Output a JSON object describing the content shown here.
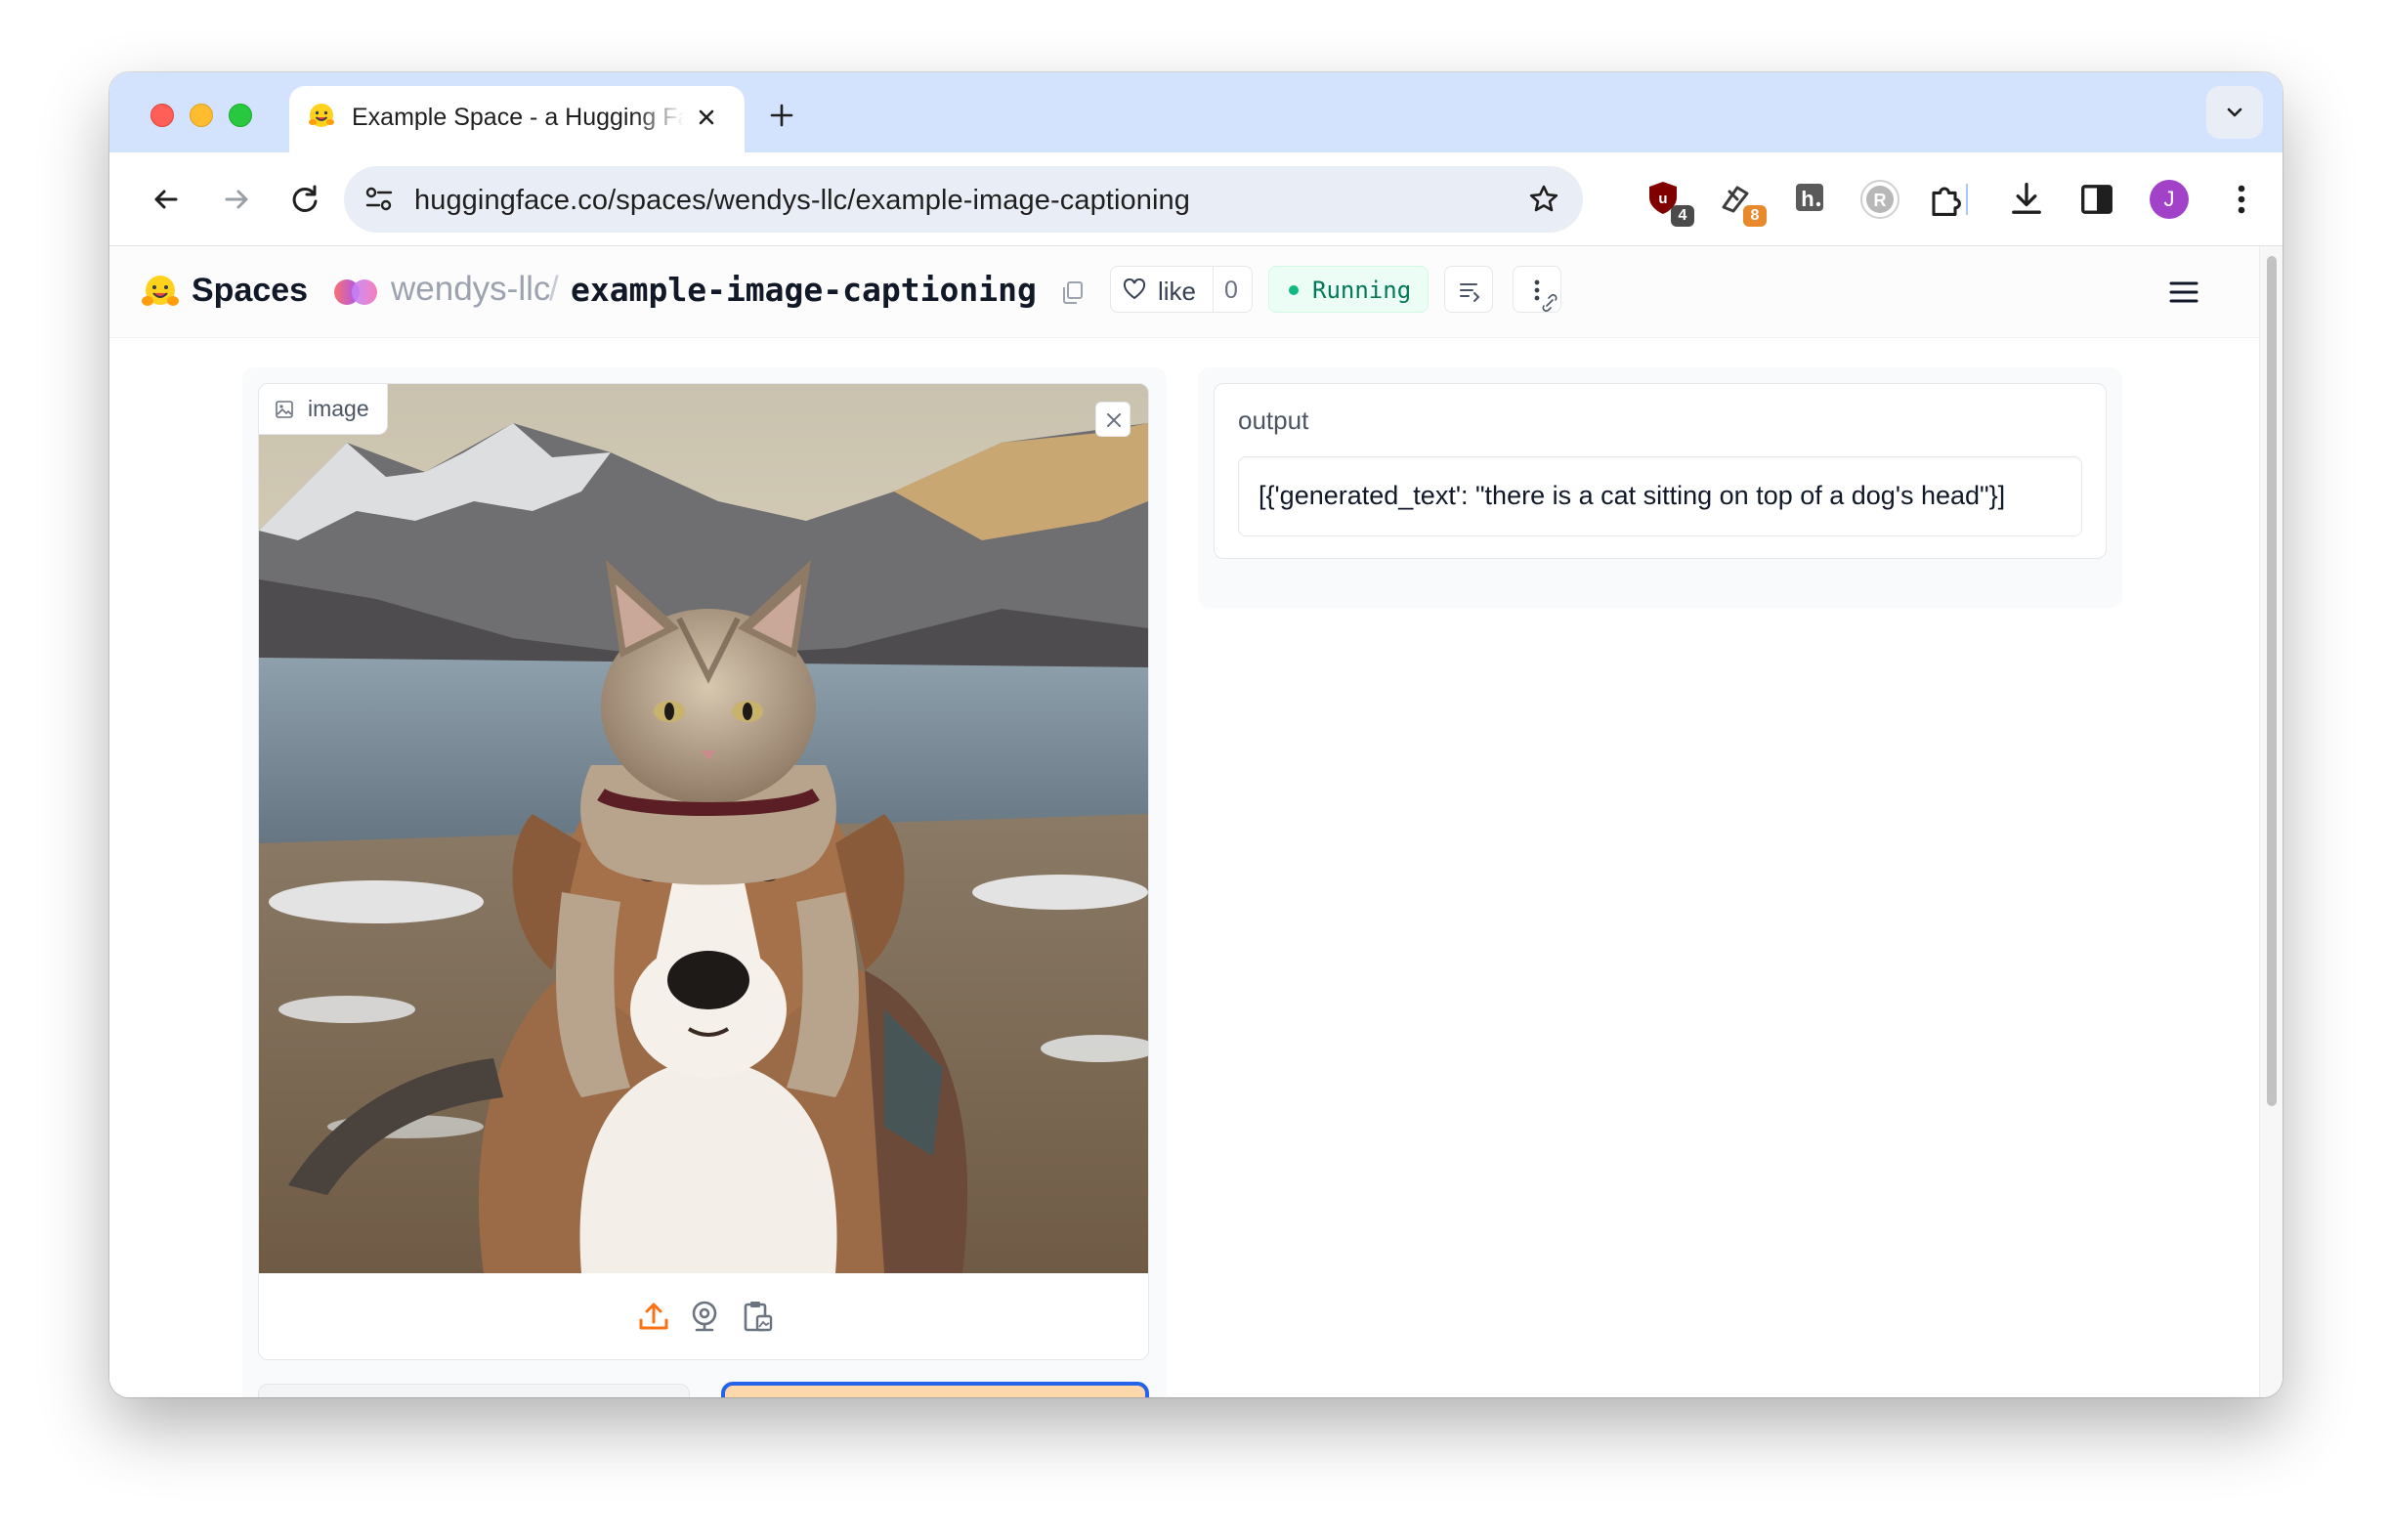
{
  "browser": {
    "tab_title": "Example Space - a Hugging Face Space by wendys-llc",
    "url": "huggingface.co/spaces/wendys-llc/example-image-captioning",
    "extensions": [
      {
        "name": "ublock-icon",
        "badge": "4",
        "color": "#7a1010",
        "badge_color": "#4b4b4b"
      },
      {
        "name": "honey-icon",
        "badge": "8",
        "color": "#3c3c3c",
        "badge_color": "#e8892b"
      },
      {
        "name": "h-dot-icon",
        "badge": ""
      },
      {
        "name": "reader-icon",
        "badge": ""
      }
    ],
    "profile_initial": "J",
    "profile_color": "#a142c9"
  },
  "hf": {
    "brand": "Spaces",
    "owner": "wendys-llc",
    "separator": "/",
    "repo": "example-image-captioning",
    "like_label": "like",
    "like_count": "0",
    "status": "Running"
  },
  "app": {
    "input_label": "image",
    "output_label": "output",
    "output_value": "[{'generated_text': \"there is a cat sitting on top of a dog's head\"}]"
  },
  "colors": {
    "accent_orange": "#f97316",
    "running_green": "#10b981",
    "submit_bg": "#fed7aa",
    "focus_ring": "#2563eb"
  }
}
